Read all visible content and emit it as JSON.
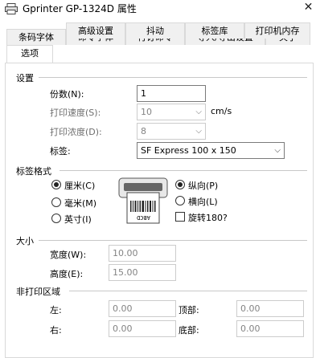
{
  "window": {
    "title": "Gprinter  GP-1324D 属性",
    "close_glyph": "✕"
  },
  "tabs_row1": [
    "条码字体",
    "命令字体",
    "行订命令",
    "导入/导出设置",
    "关于"
  ],
  "tabs_row2": [
    "选项",
    "高级设置",
    "抖动",
    "标签库",
    "打印机内存"
  ],
  "settings": {
    "group": "设置",
    "copies_label": "份数(N):",
    "copies_value": "1",
    "speed_label": "打印速度(S):",
    "speed_value": "10",
    "speed_unit": "cm/s",
    "density_label": "打印浓度(D):",
    "density_value": "8",
    "label_label": "标签:",
    "label_value": "SF Express 100 x 150"
  },
  "label_format": {
    "group": "标签格式",
    "cm": "厘米(C)",
    "mm": "毫米(M)",
    "inch": "英寸(I)",
    "portrait": "纵向(P)",
    "landscape": "横向(L)",
    "rotate": "旋转180?",
    "printer_icon_text": "ABCD",
    "units_selected": "cm",
    "orientation_selected": "portrait",
    "rotate_checked": false
  },
  "size": {
    "group": "大小",
    "width_label": "宽度(W):",
    "width_value": "10.00",
    "height_label": "高度(E):",
    "height_value": "15.00"
  },
  "nonprint": {
    "group": "非打印区域",
    "left_label": "左:",
    "left_value": "0.00",
    "top_label": "顶部:",
    "top_value": "0.00",
    "right_label": "右:",
    "right_value": "0.00",
    "bottom_label": "底部:",
    "bottom_value": "0.00"
  },
  "colors": {
    "tab_bg": "#f0f0f0",
    "border": "#d9d9d9",
    "disabled_text": "#838383"
  }
}
